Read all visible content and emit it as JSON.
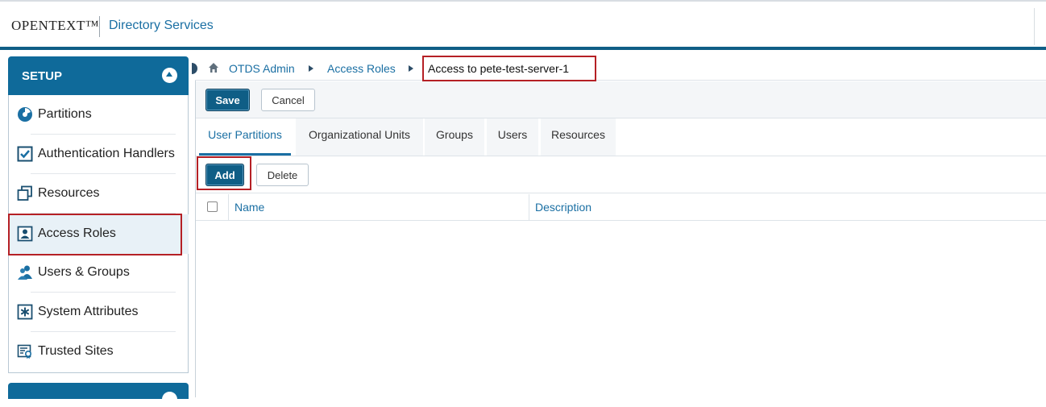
{
  "header": {
    "logo": "OPENTEXT™",
    "app_title": "Directory Services"
  },
  "sidebar": {
    "section_title": "SETUP",
    "items": [
      {
        "label": "Partitions",
        "icon": "partitions-icon"
      },
      {
        "label": "Authentication Handlers",
        "icon": "checkbox-icon"
      },
      {
        "label": "Resources",
        "icon": "resources-icon"
      },
      {
        "label": "Access Roles",
        "icon": "access-roles-icon",
        "selected": true
      },
      {
        "label": "Users & Groups",
        "icon": "users-groups-icon"
      },
      {
        "label": "System Attributes",
        "icon": "asterisk-icon"
      },
      {
        "label": "Trusted Sites",
        "icon": "certificate-icon"
      }
    ]
  },
  "breadcrumb": {
    "home_icon": "home-icon",
    "items": [
      "OTDS Admin",
      "Access Roles"
    ],
    "current": "Access to pete-test-server-1"
  },
  "toolbar": {
    "save_label": "Save",
    "cancel_label": "Cancel"
  },
  "tabs": [
    {
      "label": "User Partitions",
      "active": true
    },
    {
      "label": "Organizational Units"
    },
    {
      "label": "Groups"
    },
    {
      "label": "Users"
    },
    {
      "label": "Resources"
    }
  ],
  "actions": {
    "add_label": "Add",
    "delete_label": "Delete"
  },
  "table": {
    "columns": [
      "Name",
      "Description"
    ],
    "rows": []
  },
  "colors": {
    "brand_blue": "#0f5e86",
    "link_blue": "#1a6fa3",
    "highlight_red": "#b52025"
  }
}
